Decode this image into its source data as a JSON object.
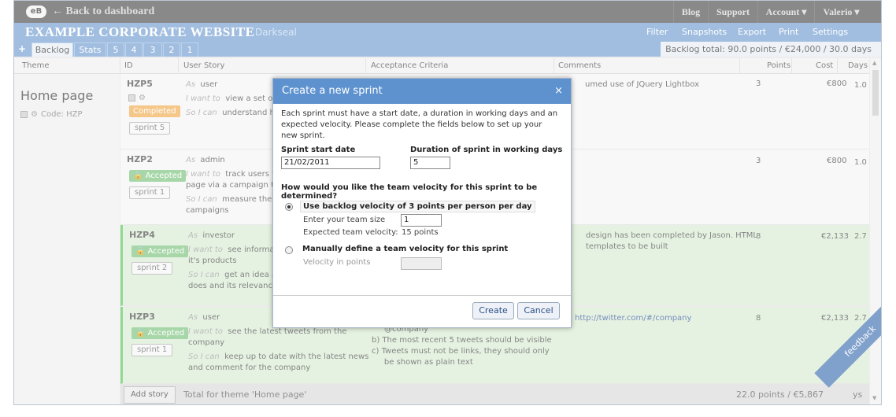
{
  "topbar": {
    "logo": "eB",
    "back": "← Back to dashboard",
    "nav": [
      "Blog",
      "Support",
      "Account ▾",
      "Valerio ▾"
    ]
  },
  "header": {
    "title": "EXAMPLE CORPORATE WEBSITE",
    "theme": "Darkseal",
    "nav": [
      "Filter",
      "Snapshots",
      "Export",
      "Print",
      "Settings"
    ]
  },
  "tabs": {
    "plus": "+",
    "items": [
      "Backlog",
      "Stats",
      "5",
      "4",
      "3",
      "2",
      "1"
    ],
    "backlog_total": "Backlog total:  90.0 points / €24,000 / 30.0 days"
  },
  "columns": [
    "Theme",
    "ID",
    "User Story",
    "Acceptance Criteria",
    "Comments",
    "Points",
    "Cost",
    "Days"
  ],
  "theme": {
    "title": "Home page",
    "code": "Code:  HZP"
  },
  "stories": [
    {
      "id": "HZP5",
      "status": "Completed",
      "sprint": "sprint 5",
      "as": "user",
      "want": "view a set of",
      "so": "understand ho",
      "comment": "umed use of JQuery Lightbox",
      "points": "3",
      "cost": "€800",
      "days": "1.0"
    },
    {
      "id": "HZP2",
      "status": "🔒 Accepted",
      "sprint": "sprint 1",
      "as": "admin",
      "want": "track users w",
      "want2": "page via a campaign UI",
      "so": "measure the e",
      "so2": "campaigns",
      "comment": "",
      "points": "3",
      "cost": "€800",
      "days": "1.0"
    },
    {
      "id": "HZP4",
      "status": "🔒 Accepted",
      "sprint": "sprint 2",
      "as": "investor",
      "want": "see informatio",
      "want2": "it's products",
      "so": "get an idea ab",
      "so2": "does and its relevance",
      "comment": "design has been completed by Jason. HTML",
      "comment2": "templates to be built",
      "points": "8",
      "cost": "€2,133",
      "days": "2.7"
    },
    {
      "id": "HZP3",
      "status": "🔒 Accepted",
      "sprint": "sprint 1",
      "as": "user",
      "want": "see the latest tweets from the",
      "want2": "company",
      "so": "keep up to date with the latest news",
      "so2": "and comment for the company",
      "crit": [
        "@company",
        "b)  The most recent 5 tweets should be visible",
        "c)  Tweets must not be links, they should only",
        "     be shown as plain text"
      ],
      "comment": "http://twitter.com/#/company",
      "points": "8",
      "cost": "€2,133",
      "days": "2.7"
    }
  ],
  "story_labels": {
    "as": "As",
    "want": "I want to",
    "so": "So I can"
  },
  "footer": {
    "add": "Add story",
    "total": "Total for theme 'Home page'",
    "right": "22.0 points / €5,867",
    "days": "ys"
  },
  "feedback": "feedback",
  "dialog": {
    "title": "Create a new sprint",
    "close": "×",
    "intro": "Each sprint must have a start date, a duration in working days and an expected velocity. Please complete the fields below to set up your new sprint.",
    "start_label": "Sprint start date",
    "start_value": "21/02/2011",
    "duration_label": "Duration of sprint in working days",
    "duration_value": "5",
    "question": "How would you like the team velocity for this sprint to be determined?",
    "opt1": "Use backlog velocity of 3 points per person per day",
    "team_size_label": "Enter your team size",
    "team_size_value": "1",
    "expected_label": "Expected team velocity:",
    "expected_value": "15 points",
    "opt2": "Manually define a team velocity for this sprint",
    "velocity_label": "Velocity in points",
    "create": "Create",
    "cancel": "Cancel"
  },
  "colors": {
    "header": "#6f9cd0",
    "dialog_title": "#5e92cf",
    "completed": "#f0a94a",
    "accepted": "#79c27a",
    "green_row": "#d8ecd2"
  }
}
